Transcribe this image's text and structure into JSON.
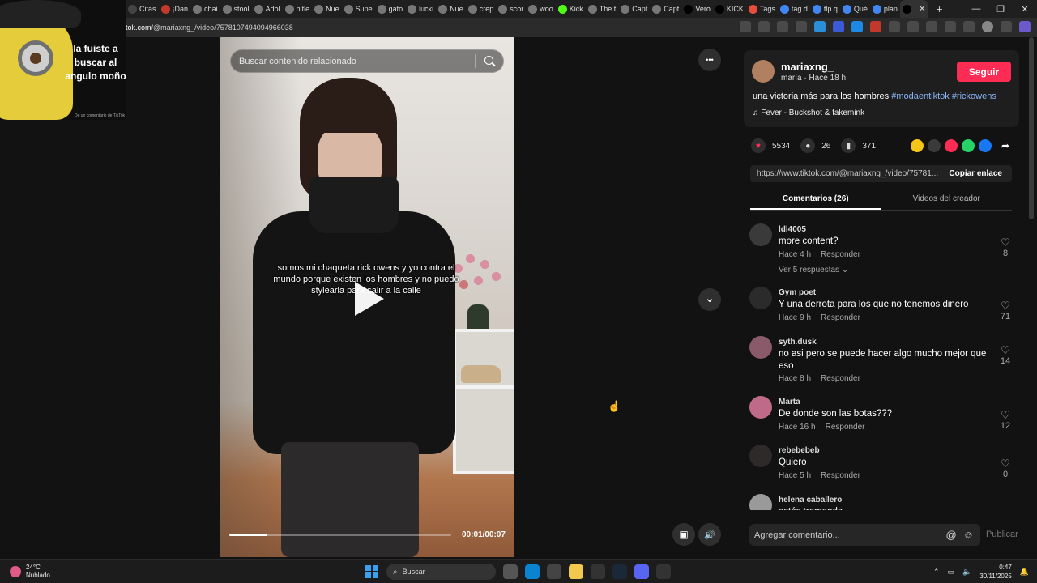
{
  "browser": {
    "tabs": [
      {
        "label": "Citas",
        "color": "#444444"
      },
      {
        "label": "¡Dan",
        "color": "#c0392b"
      },
      {
        "label": "chai",
        "color": "#777777"
      },
      {
        "label": "stool",
        "color": "#777777"
      },
      {
        "label": "Adol",
        "color": "#777777"
      },
      {
        "label": "hitle",
        "color": "#777777"
      },
      {
        "label": "Nue",
        "color": "#777777"
      },
      {
        "label": "Supe",
        "color": "#777777"
      },
      {
        "label": "gato",
        "color": "#777777"
      },
      {
        "label": "lucki",
        "color": "#777777"
      },
      {
        "label": "Nue",
        "color": "#777777"
      },
      {
        "label": "crep",
        "color": "#777777"
      },
      {
        "label": "scor",
        "color": "#777777"
      },
      {
        "label": "woo",
        "color": "#777777"
      },
      {
        "label": "Kick",
        "color": "#53fc18"
      },
      {
        "label": "The t",
        "color": "#777777"
      },
      {
        "label": "Capt",
        "color": "#777777"
      },
      {
        "label": "Capt",
        "color": "#777777"
      },
      {
        "label": "Vero",
        "color": "#000000"
      },
      {
        "label": "KICK",
        "color": "#000000"
      },
      {
        "label": "Tags",
        "color": "#e74c3c"
      },
      {
        "label": "tag d",
        "color": "#4285f4"
      },
      {
        "label": "tlp q",
        "color": "#4285f4"
      },
      {
        "label": "Qué",
        "color": "#4285f4"
      },
      {
        "label": "plan",
        "color": "#4285f4"
      }
    ],
    "active_tab": {
      "label": "",
      "close": "✕"
    },
    "new_tab": "+",
    "window_controls": {
      "minimize": "—",
      "maximize": "❐",
      "close": "✕"
    },
    "url_host": "tok.com",
    "url_path": "/@mariaxng_/video/7578107494094966038"
  },
  "meme": {
    "text": "la fuiste a buscar al angulo moño",
    "credit": "De un comentario de TikTok"
  },
  "video": {
    "search_placeholder": "Buscar contenido relacionado",
    "caption": "somos mi chaqueta rick owens y yo contra el mundo porque existen los hombres y no puedo stylearla para salir a la calle",
    "time": "00:01/00:07",
    "progress": 0.17,
    "more_icon": "•••",
    "down_icon": "⌄",
    "mute_icon": "🔊",
    "pip_icon": "▣"
  },
  "post": {
    "username": "mariaxng_",
    "meta": "maría · Hace 18 h",
    "follow_label": "Seguir",
    "description": "una victoria más para los hombres",
    "hashtags": [
      "#modaentiktok",
      "#rickowens"
    ],
    "music": "♫  Fever - Buckshot & fakemink",
    "likes": "5534",
    "comments_count": "26",
    "saves": "371",
    "link": "https://www.tiktok.com/@mariaxng_/video/75781...",
    "copy_label": "Copiar enlace",
    "tab_comments": "Comentarios (26)",
    "tab_videos": "Videos del creador",
    "share_colors": [
      "#f5c518",
      "#3a3a3a",
      "#fe2c55",
      "#25d366",
      "#1877f2"
    ]
  },
  "comments": [
    {
      "user": "ldl4005",
      "text": "more content?",
      "time": "Hace 4 h",
      "reply": "Responder",
      "likes": "8",
      "replies": "Ver 5 respuestas ⌄",
      "avatar": "#3a3a3a"
    },
    {
      "user": "Gym poet",
      "text": "Y una derrota para los que no tenemos dinero",
      "time": "Hace 9 h",
      "reply": "Responder",
      "likes": "71",
      "avatar": "#2b2b2b"
    },
    {
      "user": "syth.dusk",
      "text": "no asi pero se puede hacer algo mucho mejor que eso",
      "time": "Hace 8 h",
      "reply": "Responder",
      "likes": "14",
      "avatar": "#8a5a6a"
    },
    {
      "user": "Marta",
      "text": "De donde son las botas???",
      "time": "Hace 16 h",
      "reply": "Responder",
      "likes": "12",
      "avatar": "#c06a8a"
    },
    {
      "user": "rebebebeb",
      "text": "Quiero",
      "time": "Hace 5 h",
      "reply": "Responder",
      "likes": "0",
      "avatar": "#2e2a2a"
    },
    {
      "user": "helena caballero",
      "text": "estás tremenda",
      "time": "",
      "reply": "",
      "likes": "",
      "avatar": "#9a9a9a"
    }
  ],
  "compose": {
    "placeholder": "Agregar comentario...",
    "mention_icon": "@",
    "emoji_icon": "☺",
    "publish": "Publicar"
  },
  "taskbar": {
    "temp": "24°C",
    "weather": "Nublado",
    "search": "Buscar",
    "time": "0:47",
    "date": "30/11/2025",
    "app_colors": [
      "#555555",
      "#0a84d0",
      "#444444",
      "#f2c94c",
      "#333333",
      "#1b2838",
      "#5865f2",
      "#333333"
    ]
  }
}
